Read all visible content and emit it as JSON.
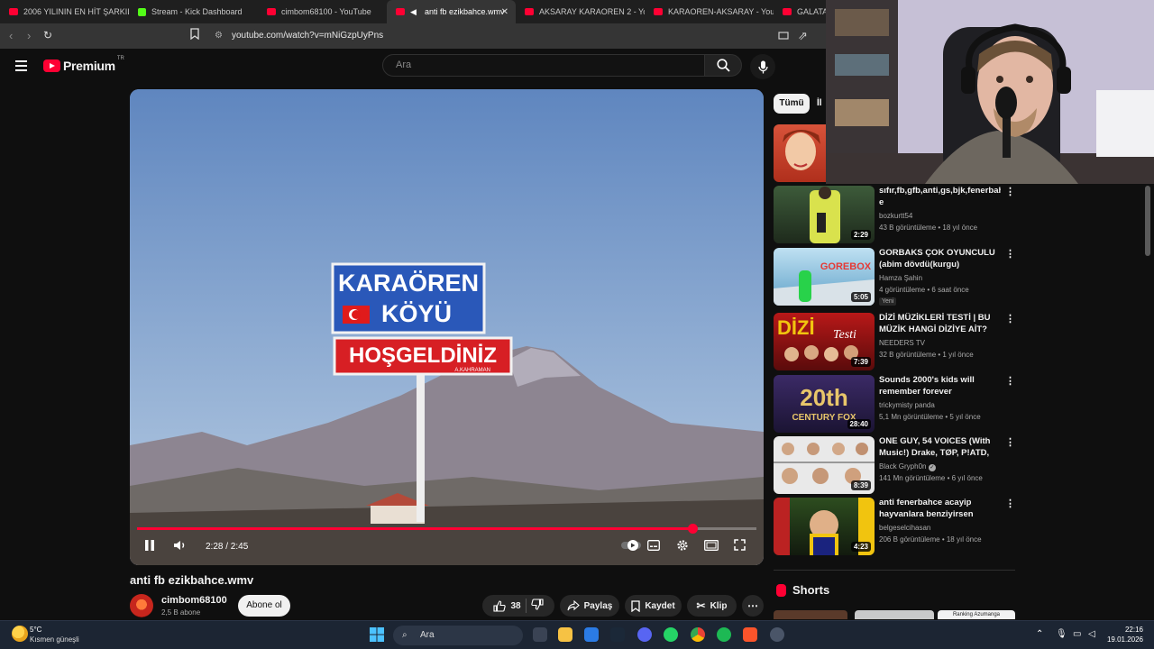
{
  "browser": {
    "tabs": [
      {
        "title": "2006 YILININ EN HİT ŞARKILAR",
        "icon": "youtube-icon",
        "active": false
      },
      {
        "title": "Stream - Kick Dashboard",
        "icon": "kick-icon",
        "active": false
      },
      {
        "title": "cimbom68100 - YouTube",
        "icon": "youtube-icon",
        "active": false
      },
      {
        "title": "anti fb ezikbahce.wmv",
        "icon": "youtube-icon",
        "active": true
      },
      {
        "title": "AKSARAY KARAOREN 2 - YouT",
        "icon": "youtube-icon",
        "active": false
      },
      {
        "title": "KARAOREN-AKSARAY - YouTu",
        "icon": "youtube-icon",
        "active": false
      },
      {
        "title": "GALATASA",
        "icon": "youtube-icon",
        "active": false
      }
    ],
    "url": "youtube.com/watch?v=mNiGzpUyPns"
  },
  "header": {
    "brand": "Premium",
    "country_code": "TR",
    "search_placeholder": "Ara"
  },
  "player": {
    "time": "2:28 / 2:45",
    "progress_fraction": 0.897,
    "sign_line1": "KARAÖREN",
    "sign_line2": "KÖYÜ",
    "sign_line3": "HOŞGELDİNİZ",
    "sign_small": "A.KAHRAMAN"
  },
  "video": {
    "title": "anti fb ezikbahce.wmv",
    "channel": "cimbom68100",
    "subscribers": "2,5 B abone",
    "subscribe_label": "Abone ol",
    "likes": "38",
    "share_label": "Paylaş",
    "save_label": "Kaydet",
    "clip_label": "Klip"
  },
  "sidebar": {
    "chip_all": "Tümü",
    "chip_next": "İl",
    "recommendations": [
      {
        "title": "sıfır,fb,gfb,anti,gs,bjk,fenerbahç e",
        "channel": "bozkurtt54",
        "meta": "43 B görüntüleme • 18 yıl önce",
        "duration": "2:29",
        "badge": "",
        "verified": false
      },
      {
        "title": "GORBAKS ÇOK OYUNCULU (abim dövdü(kurgu)",
        "channel": "Hamza Şahin",
        "meta": "4 görüntüleme • 6 saat önce",
        "duration": "5:05",
        "badge": "Yeni",
        "verified": false
      },
      {
        "title": "DİZİ MÜZİKLERİ TESTİ | BU MÜZİK HANGİ DİZİYE AİT?",
        "channel": "NEEDERS TV",
        "meta": "32 B görüntüleme • 1 yıl önce",
        "duration": "7:39",
        "badge": "",
        "verified": false
      },
      {
        "title": "Sounds 2000's kids will remember forever",
        "channel": "trickymisty panda",
        "meta": "5,1 Mn görüntüleme • 5 yıl önce",
        "duration": "28:40",
        "badge": "",
        "verified": false
      },
      {
        "title": "ONE GUY, 54 VOICES (With Music!) Drake, TØP, P!ATD, Put...",
        "channel": "Black Gryph0n",
        "meta": "141 Mn görüntüleme • 6 yıl önce",
        "duration": "8:39",
        "badge": "",
        "verified": true
      },
      {
        "title": "anti fenerbahce acayip hayvanlara benziyirsen",
        "channel": "belgeselcihasan",
        "meta": "206 B görüntüleme • 18 yıl önce",
        "duration": "4:23",
        "badge": "",
        "verified": false
      }
    ],
    "thumb_texts": {
      "gorebox": "GOREBOX",
      "dizi": "Testi",
      "fox_big": "20th",
      "fox_small": "CENTURY FOX"
    },
    "shorts_title": "Shorts",
    "shorts_thumb_text": "Ranking Azumanga"
  },
  "taskbar": {
    "temperature": "5°C",
    "weather": "Kısmen güneşli",
    "search_placeholder": "Ara",
    "time": "22:16",
    "date": "19.01.2026"
  }
}
